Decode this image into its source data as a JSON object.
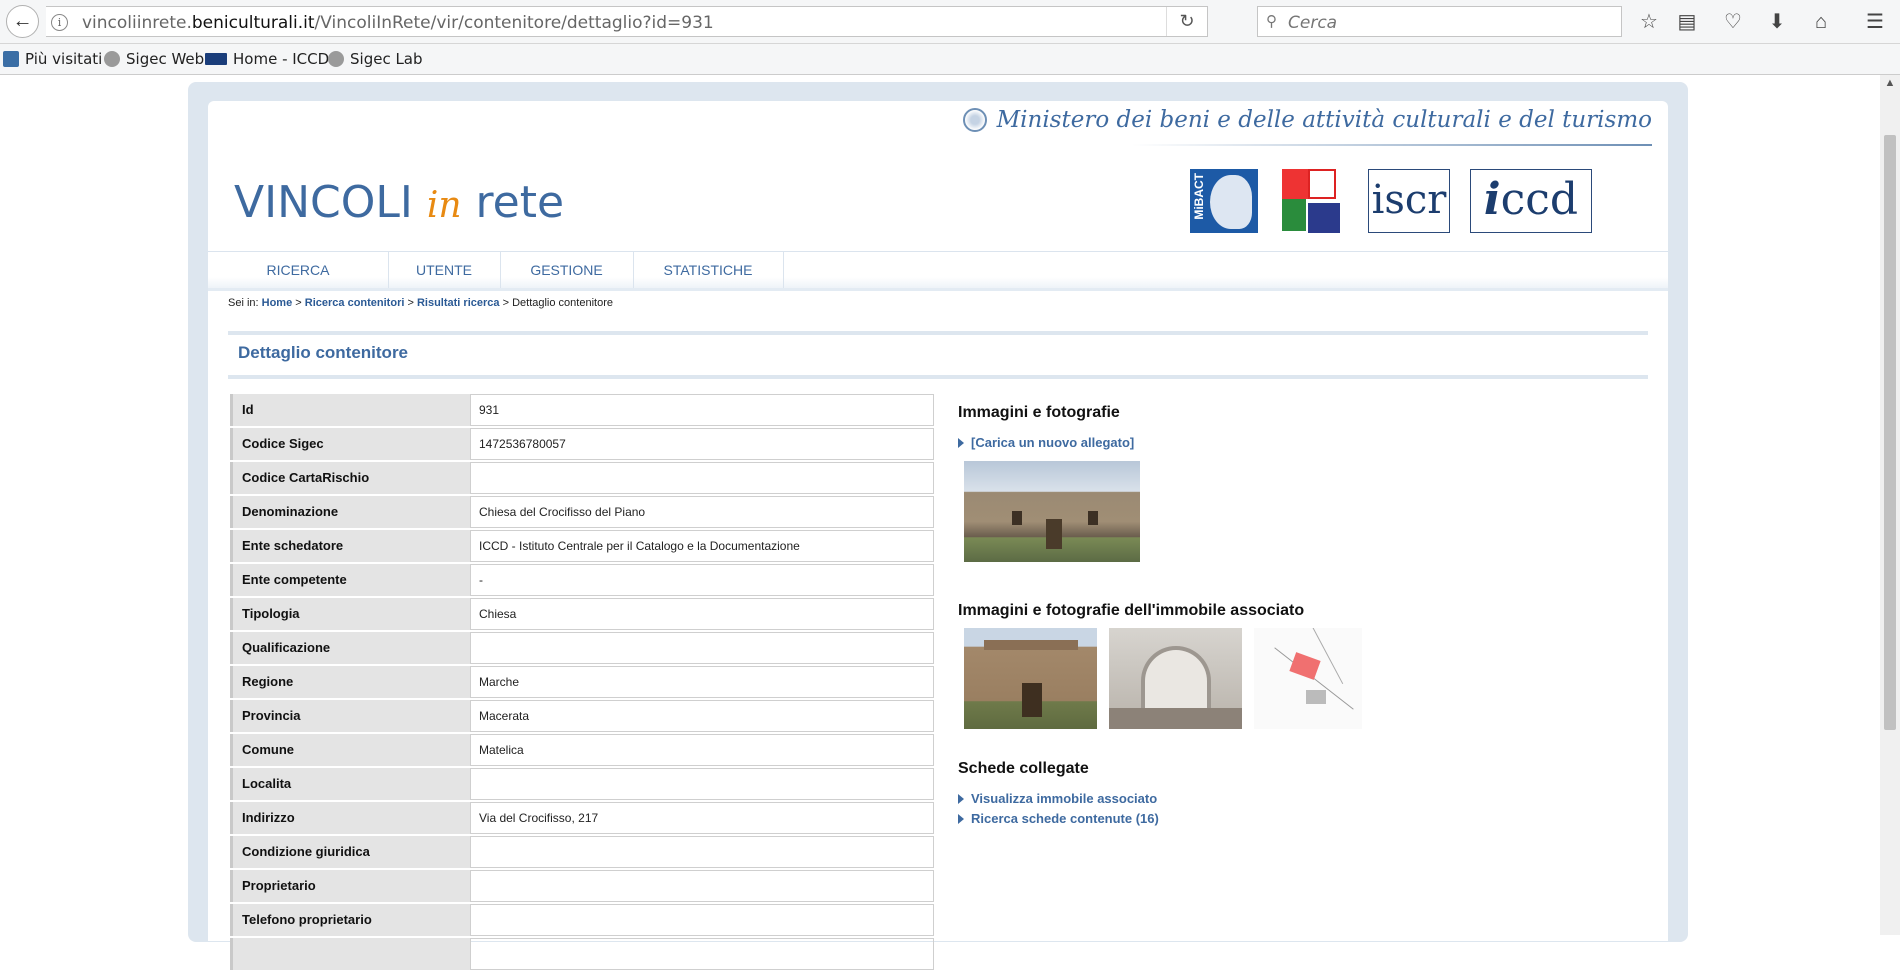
{
  "browser": {
    "url_prefix": "vincoliinrete.",
    "url_domain": "beniculturali.it",
    "url_path": "/VincoliInRete/vir/contenitore/dettaglio?id=931",
    "search_placeholder": "Cerca"
  },
  "bookmarks": [
    {
      "label": "Più visitati"
    },
    {
      "label": "Sigec Web"
    },
    {
      "label": "Home - ICCD"
    },
    {
      "label": "Sigec Lab"
    }
  ],
  "header": {
    "ministry": "Ministero dei beni e delle attività culturali e del turismo",
    "title_a": "VINCOLI",
    "title_in": "in",
    "title_b": "rete",
    "logo_mibac": "MiBACT",
    "logo_iscr": "iscr",
    "logo_iccd_i": "i",
    "logo_iccd": "ccd"
  },
  "nav": [
    {
      "label": "RICERCA"
    },
    {
      "label": "UTENTE"
    },
    {
      "label": "GESTIONE"
    },
    {
      "label": "STATISTICHE"
    }
  ],
  "breadcrumb": {
    "prefix": "Sei in:",
    "home": "Home",
    "sep": ">",
    "ricerca": "Ricerca contenitori",
    "risultati": "Risultati ricerca",
    "current": "Dettaglio contenitore"
  },
  "section_title": "Dettaglio contenitore",
  "details": [
    {
      "label": "Id",
      "value": "931"
    },
    {
      "label": "Codice Sigec",
      "value": "1472536780057"
    },
    {
      "label": "Codice CartaRischio",
      "value": ""
    },
    {
      "label": "Denominazione",
      "value": "Chiesa del Crocifisso del Piano"
    },
    {
      "label": "Ente schedatore",
      "value": "ICCD - Istituto Centrale per il Catalogo e la Documentazione"
    },
    {
      "label": "Ente competente",
      "value": "-"
    },
    {
      "label": "Tipologia",
      "value": "Chiesa"
    },
    {
      "label": "Qualificazione",
      "value": ""
    },
    {
      "label": "Regione",
      "value": "Marche"
    },
    {
      "label": "Provincia",
      "value": "Macerata"
    },
    {
      "label": "Comune",
      "value": "Matelica"
    },
    {
      "label": "Localita",
      "value": ""
    },
    {
      "label": "Indirizzo",
      "value": "Via del Crocifisso, 217"
    },
    {
      "label": "Condizione giuridica",
      "value": ""
    },
    {
      "label": "Proprietario",
      "value": ""
    },
    {
      "label": "Telefono proprietario",
      "value": ""
    }
  ],
  "right": {
    "images_title": "Immagini e fotografie",
    "upload_link": "[Carica un nuovo allegato]",
    "assoc_images_title": "Immagini e fotografie dell'immobile associato",
    "linked_title": "Schede collegate",
    "link_view": "Visualizza immobile associato",
    "link_search": "Ricerca schede contenute (16)"
  }
}
